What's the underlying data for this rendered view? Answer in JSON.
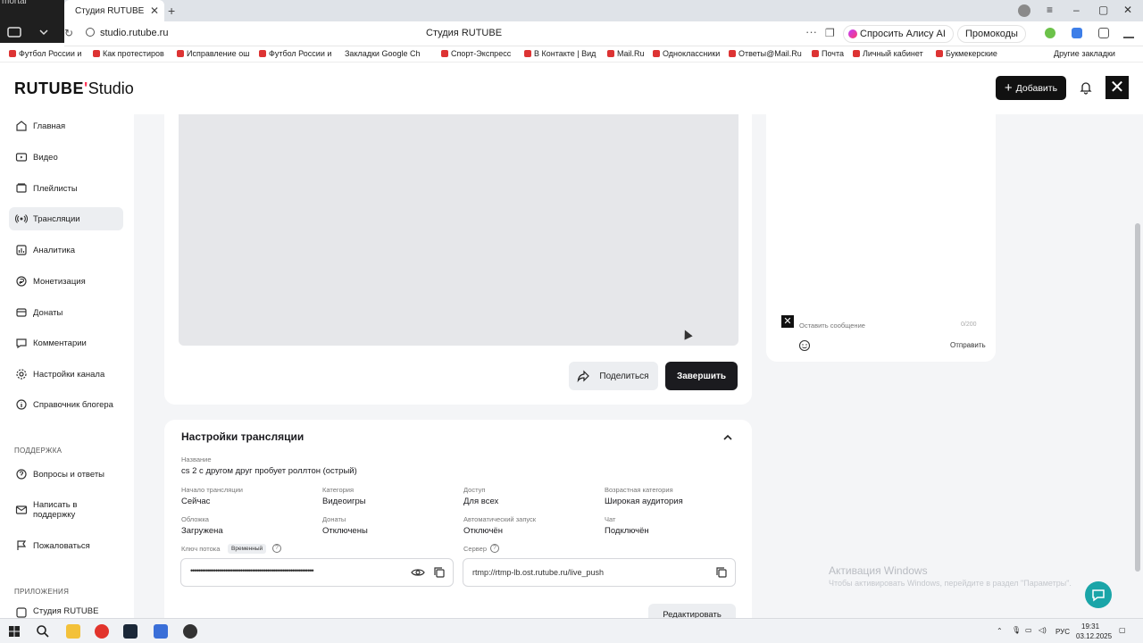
{
  "browser": {
    "left_tile_text": "mortal",
    "tab_title": "Студия RUTUBE",
    "url": "studio.rutube.ru",
    "page_title": "Студия RUTUBE",
    "alice_button": "Спросить Алису AI",
    "promo_button": "Промокоды",
    "bookmarks": [
      "Футбол России и",
      "Как протестиров",
      "Исправление ош",
      "Футбол России и",
      "Закладки Google Ch",
      "Спорт-Экспресс",
      "В Контакте | Вид",
      "Mail.Ru",
      "Одноклассники",
      "Ответы@Mail.Ru",
      "Почта",
      "Личный кабинет",
      "Букмекерские"
    ],
    "other_bookmarks": "Другие закладки"
  },
  "header": {
    "logo_main": "RUTUBE",
    "logo_suffix": "Studio",
    "add_button": "Добавить"
  },
  "sidebar": {
    "items": [
      {
        "label": "Главная",
        "icon": "home-icon"
      },
      {
        "label": "Видео",
        "icon": "video-icon"
      },
      {
        "label": "Плейлисты",
        "icon": "playlist-icon"
      },
      {
        "label": "Трансляции",
        "icon": "broadcast-icon",
        "active": true
      },
      {
        "label": "Аналитика",
        "icon": "analytics-icon"
      },
      {
        "label": "Монетизация",
        "icon": "monetization-icon"
      },
      {
        "label": "Донаты",
        "icon": "donate-icon"
      },
      {
        "label": "Комментарии",
        "icon": "comments-icon"
      },
      {
        "label": "Настройки канала",
        "icon": "gear-icon"
      },
      {
        "label": "Справочник блогера",
        "icon": "info-icon"
      }
    ],
    "support_section": "ПОДДЕРЖКА",
    "support_items": [
      {
        "label": "Вопросы и ответы",
        "icon": "help-circle-icon"
      },
      {
        "label": "Написать в поддержку",
        "icon": "mail-icon"
      },
      {
        "label": "Пожаловаться",
        "icon": "flag-icon"
      }
    ],
    "apps_section": "ПРИЛОЖЕНИЯ",
    "apps_items": [
      {
        "label": "Студия RUTUBE"
      }
    ]
  },
  "stream": {
    "share_button": "Поделиться",
    "finish_button": "Завершить"
  },
  "chat": {
    "placeholder": "Оставить сообщение",
    "counter": "0/200",
    "send_button": "Отправить"
  },
  "settings": {
    "title": "Настройки трансляции",
    "name_label": "Название",
    "name_value": "cs 2 с другом друг пробует роллтон (острый)",
    "fields": [
      {
        "label": "Начало трансляции",
        "value": "Сейчас"
      },
      {
        "label": "Категория",
        "value": "Видеоигры"
      },
      {
        "label": "Доступ",
        "value": "Для всех"
      },
      {
        "label": "Возрастная категория",
        "value": "Широкая аудитория"
      },
      {
        "label": "Обложка",
        "value": "Загружена"
      },
      {
        "label": "Донаты",
        "value": "Отключены"
      },
      {
        "label": "Автоматический запуск",
        "value": "Отключён"
      },
      {
        "label": "Чат",
        "value": "Подключён"
      }
    ],
    "key_label": "Ключ потока",
    "key_badge": "Временный",
    "key_value": "••••••••••••••••••••••••••••••••••••••••••••••••••••••••••••••••",
    "server_label": "Сервер",
    "server_value": "rtmp://rtmp-lb.ost.rutube.ru/live_push",
    "edit_button": "Редактировать"
  },
  "windows": {
    "activate_title": "Активация Windows",
    "activate_sub": "Чтобы активировать Windows, перейдите в раздел \"Параметры\".",
    "tray_lang": "РУС",
    "time": "19:31",
    "date": "03.12.2025"
  },
  "colors": {
    "accent": "#ff3355",
    "dark": "#1b1b1f",
    "teal": "#1aa5a8"
  }
}
